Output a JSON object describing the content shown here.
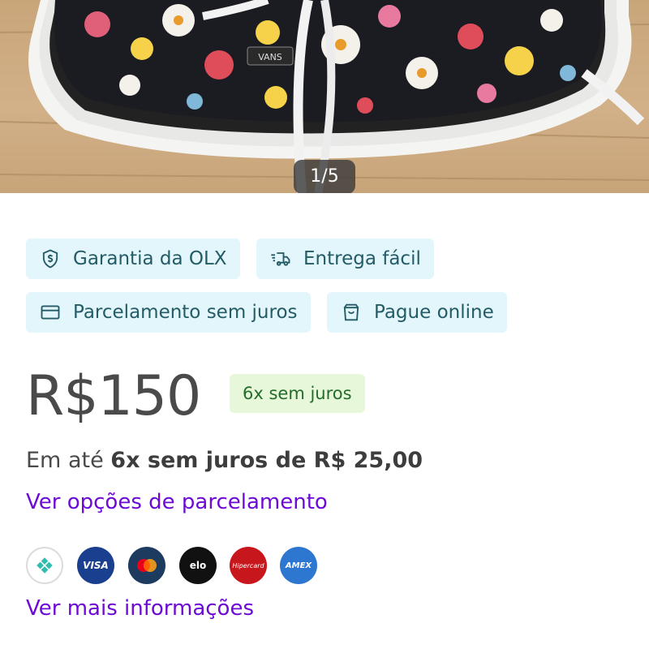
{
  "gallery": {
    "counter": "1/5",
    "brand_label": "VANS"
  },
  "features": [
    {
      "label": "Garantia da OLX",
      "icon": "shield-dollar-icon"
    },
    {
      "label": "Entrega fácil",
      "icon": "delivery-truck-icon"
    },
    {
      "label": "Parcelamento sem juros",
      "icon": "credit-card-icon"
    },
    {
      "label": "Pague online",
      "icon": "shopping-bag-icon"
    }
  ],
  "price": {
    "value": "R$150",
    "badge": "6x sem juros",
    "installment_prefix": "Em até ",
    "installment_bold": "6x sem juros de R$ 25,00",
    "options_link": "Ver opções de parcelamento"
  },
  "payment_methods": [
    {
      "name": "Pix",
      "icon": "pix-icon",
      "text": ""
    },
    {
      "name": "Visa",
      "icon": "visa-icon",
      "text": "VISA"
    },
    {
      "name": "Mastercard",
      "icon": "mastercard-icon",
      "text": ""
    },
    {
      "name": "Elo",
      "icon": "elo-icon",
      "text": "elo"
    },
    {
      "name": "Hipercard",
      "icon": "hipercard-icon",
      "text": "Hipercard"
    },
    {
      "name": "Amex",
      "icon": "amex-icon",
      "text": "AMEX"
    }
  ],
  "more_info_link": "Ver mais informações",
  "colors": {
    "chip_bg": "#e3f6fb",
    "chip_text": "#235b66",
    "badge_bg": "#e6f8d9",
    "badge_text": "#256b2a",
    "link": "#6e0ad6"
  }
}
